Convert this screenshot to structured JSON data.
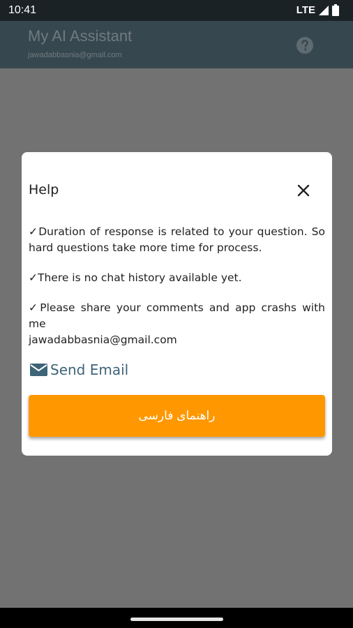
{
  "status_bar": {
    "time": "10:41",
    "network": "LTE"
  },
  "app_bar": {
    "title": "My AI Assistant",
    "subtitle": "jawadabbasnia@gmail.com",
    "help_icon": "help-circle-icon"
  },
  "dialog": {
    "title": "Help",
    "close_icon": "close-icon",
    "items": [
      "✓Duration of response is related to your question. So hard questions take more time for process.",
      "✓There is no chat history available yet.",
      "✓Please share your comments and app crashs with me"
    ],
    "email": " jawadabbasnia@gmail.com",
    "send_email_label": "Send Email",
    "send_email_icon": "mail-icon",
    "guide_button_label": "راهنمای فارسی",
    "accent_color": "#ff9800"
  }
}
